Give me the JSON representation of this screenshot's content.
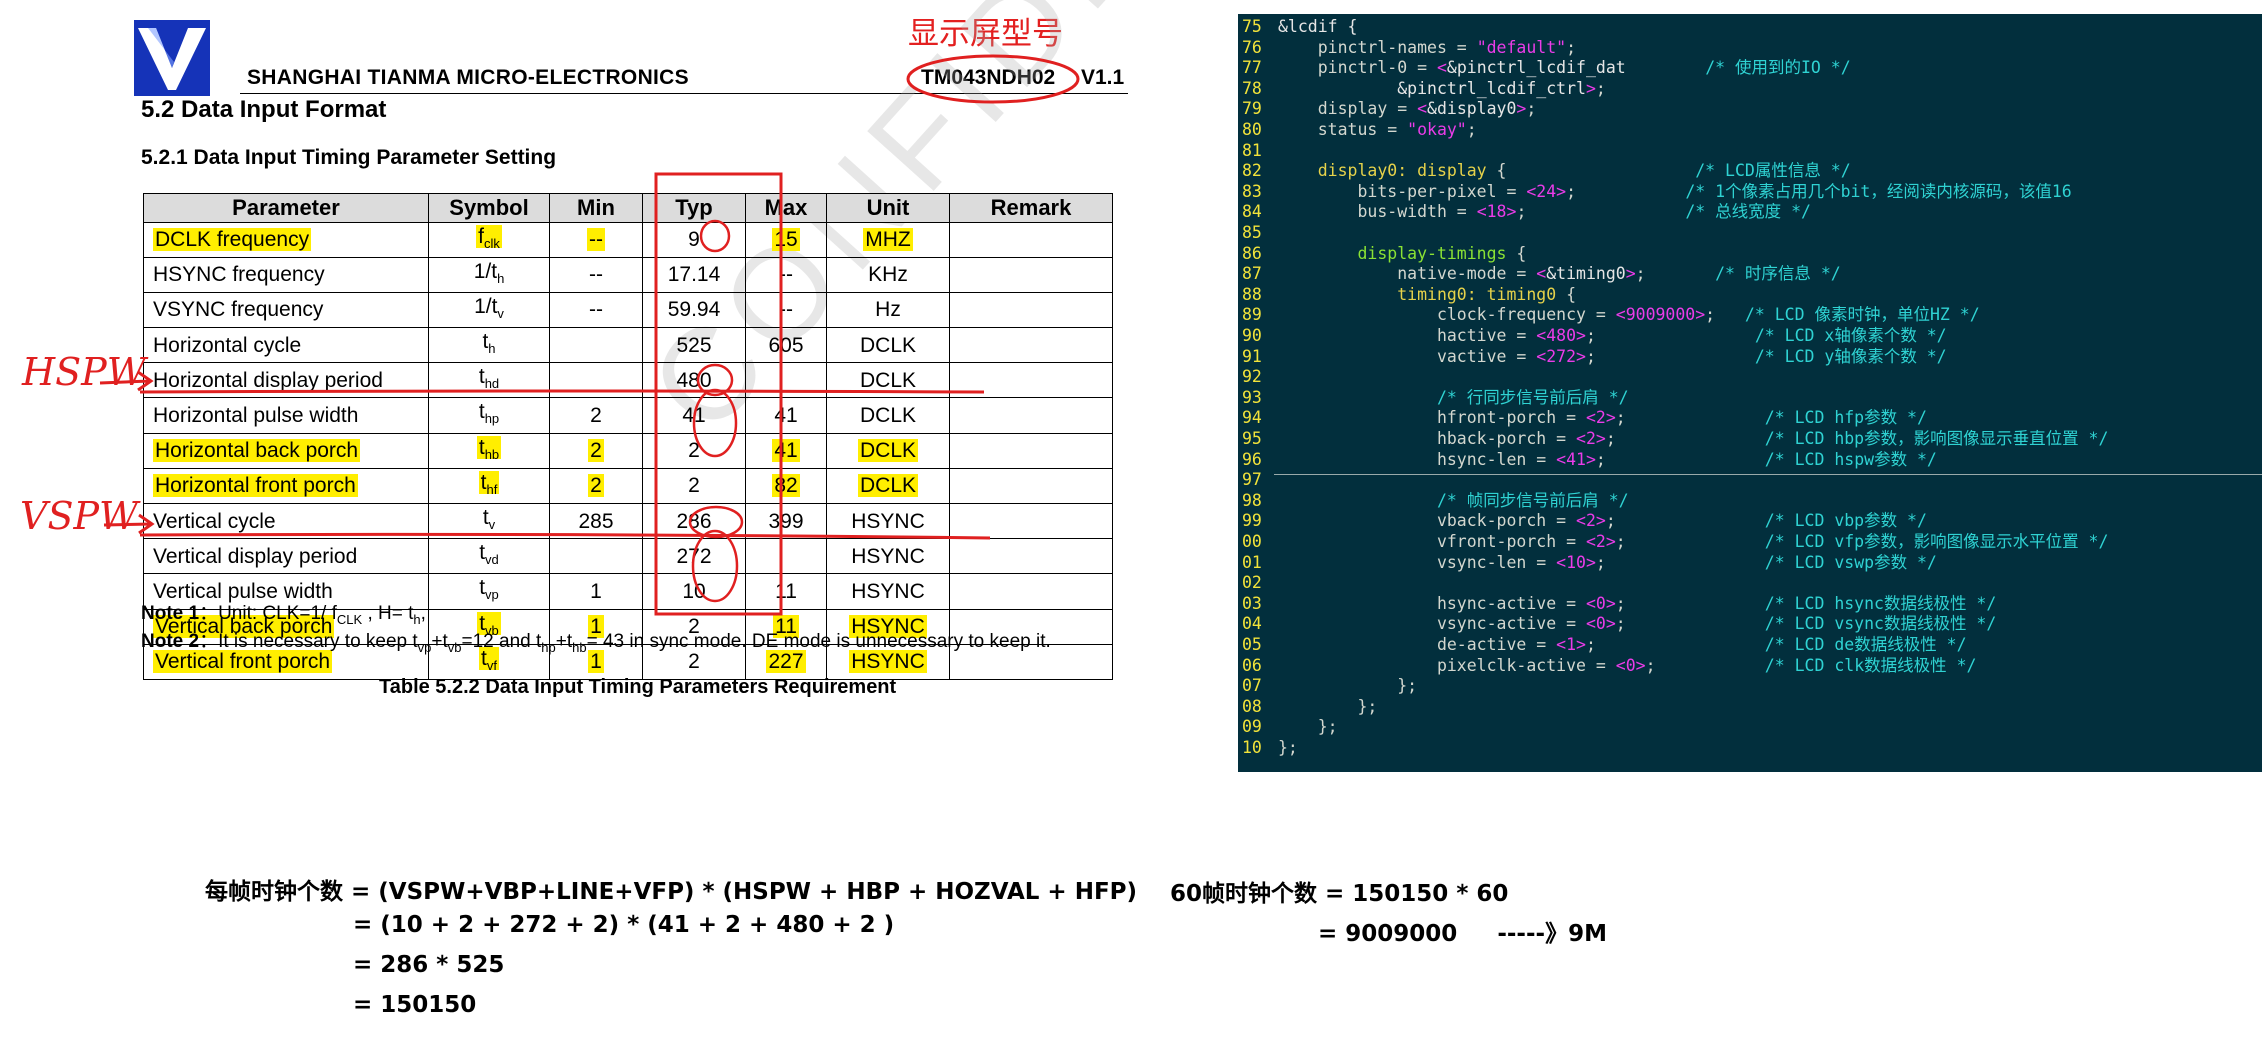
{
  "header": {
    "company": "SHANGHAI TIANMA MICRO-ELECTRONICS",
    "model": "TM043NDH02",
    "version": "V1.1",
    "cn_model_annotation": "显示屏型号"
  },
  "section_title": "5.2 Data Input Format",
  "subsection_title": "5.2.1 Data Input Timing Parameter Setting",
  "table": {
    "headers": [
      "Parameter",
      "Symbol",
      "Min",
      "Typ",
      "Max",
      "Unit",
      "Remark"
    ],
    "rows": [
      {
        "param": "DCLK frequency",
        "sym": "f",
        "sub": "clk",
        "min": "--",
        "typ": "9",
        "max": "15",
        "unit": "MHZ",
        "remark": "",
        "highlight": true
      },
      {
        "param": "HSYNC frequency",
        "sym": "1/t",
        "sub": "h",
        "min": "--",
        "typ": "17.14",
        "max": "--",
        "unit": "KHz",
        "remark": "",
        "highlight": false
      },
      {
        "param": "VSYNC frequency",
        "sym": "1/t",
        "sub": "v",
        "min": "--",
        "typ": "59.94",
        "max": "--",
        "unit": "Hz",
        "remark": "",
        "highlight": false
      },
      {
        "param": "Horizontal cycle",
        "sym": "t",
        "sub": "h",
        "min": "",
        "typ": "525",
        "max": "605",
        "unit": "DCLK",
        "remark": "",
        "highlight": false
      },
      {
        "param": "Horizontal display period",
        "sym": "t",
        "sub": "hd",
        "min": "",
        "typ": "480",
        "max": "",
        "unit": "DCLK",
        "remark": "",
        "highlight": false
      },
      {
        "param": "Horizontal pulse width",
        "sym": "t",
        "sub": "hp",
        "min": "2",
        "typ": "41",
        "max": "41",
        "unit": "DCLK",
        "remark": "",
        "highlight": false
      },
      {
        "param": "Horizontal back porch",
        "sym": "t",
        "sub": "hb",
        "min": "2",
        "typ": "2",
        "max": "41",
        "unit": "DCLK",
        "remark": "",
        "highlight": true
      },
      {
        "param": "Horizontal front porch",
        "sym": "t",
        "sub": "hf",
        "min": "2",
        "typ": "2",
        "max": "82",
        "unit": "DCLK",
        "remark": "",
        "highlight": true
      },
      {
        "param": "Vertical cycle",
        "sym": "t",
        "sub": "v",
        "min": "285",
        "typ": "286",
        "max": "399",
        "unit": "HSYNC",
        "remark": "",
        "highlight": false
      },
      {
        "param": "Vertical display period",
        "sym": "t",
        "sub": "vd",
        "min": "",
        "typ": "272",
        "max": "",
        "unit": "HSYNC",
        "remark": "",
        "highlight": false
      },
      {
        "param": "Vertical pulse width",
        "sym": "t",
        "sub": "vp",
        "min": "1",
        "typ": "10",
        "max": "11",
        "unit": "HSYNC",
        "remark": "",
        "highlight": false
      },
      {
        "param": "Vertical back porch",
        "sym": "t",
        "sub": "vb",
        "min": "1",
        "typ": "2",
        "max": "11",
        "unit": "HSYNC",
        "remark": "",
        "highlight": true
      },
      {
        "param": "Vertical front porch",
        "sym": "t",
        "sub": "vf",
        "min": "1",
        "typ": "2",
        "max": "227",
        "unit": "HSYNC",
        "remark": "",
        "highlight": true
      }
    ]
  },
  "notes": {
    "note1_label": "Note 1",
    "note1_text": "：Unit: CLK=1/ f",
    "note1_sub": "CLK",
    "note1_tail": " , H= t",
    "note1_tail_sub": "h",
    "note1_end": ",",
    "note2_label": "Note 2",
    "note2_text": "：It is necessary to keep t",
    "note2_p1": "vp",
    "note2_p2": "+t",
    "note2_p3": "vb",
    "note2_p4": "=12 and t",
    "note2_p5": "hp",
    "note2_p6": "+t",
    "note2_p7": "hb",
    "note2_p8": "= 43 in sync mode. DE mode is unnecessary to keep it."
  },
  "caption": "Table 5.2.2 Data Input Timing Parameters Requirement",
  "watermark": "CONFIDENTIAL",
  "hand_labels": {
    "hspw": "HSPW",
    "vspw": "VSPW"
  },
  "code": {
    "lines": [
      {
        "n": "75",
        "t": [
          [
            "w",
            "&lcdif {"
          ]
        ]
      },
      {
        "n": "76",
        "t": [
          [
            "d",
            "    pinctrl-names = "
          ],
          [
            "p",
            "\"default\""
          ],
          [
            "d",
            ";"
          ]
        ]
      },
      {
        "n": "77",
        "t": [
          [
            "d",
            "    pinctrl-0 = "
          ],
          [
            "p",
            "<"
          ],
          [
            "w",
            "&pinctrl_lcdif_dat"
          ],
          [
            "d",
            "        "
          ],
          [
            "c",
            "/* 使用到的IO */"
          ]
        ]
      },
      {
        "n": "78",
        "t": [
          [
            "d",
            "            "
          ],
          [
            "w",
            "&pinctrl_lcdif_ctrl"
          ],
          [
            "p",
            ">"
          ],
          [
            "d",
            ";"
          ]
        ]
      },
      {
        "n": "79",
        "t": [
          [
            "d",
            "    display = "
          ],
          [
            "p",
            "<"
          ],
          [
            "w",
            "&display0"
          ],
          [
            "p",
            ">"
          ],
          [
            "d",
            ";"
          ]
        ]
      },
      {
        "n": "80",
        "t": [
          [
            "d",
            "    status = "
          ],
          [
            "p",
            "\"okay\""
          ],
          [
            "d",
            ";"
          ]
        ]
      },
      {
        "n": "81",
        "t": []
      },
      {
        "n": "82",
        "t": [
          [
            "y",
            "    display0: display "
          ],
          [
            "d",
            "{"
          ],
          [
            "d",
            "                   "
          ],
          [
            "c",
            "/* LCD属性信息 */"
          ]
        ]
      },
      {
        "n": "83",
        "t": [
          [
            "d",
            "        bits-per-pixel = "
          ],
          [
            "p",
            "<24>"
          ],
          [
            "d",
            ";"
          ],
          [
            "d",
            "           "
          ],
          [
            "c",
            "/* 1个像素占用几个bit，经阅读内核源码，该值16"
          ]
        ]
      },
      {
        "n": "84",
        "t": [
          [
            "d",
            "        bus-width = "
          ],
          [
            "p",
            "<18>"
          ],
          [
            "d",
            ";"
          ],
          [
            "d",
            "                "
          ],
          [
            "c",
            "/* 总线宽度 */"
          ]
        ]
      },
      {
        "n": "85",
        "t": []
      },
      {
        "n": "86",
        "t": [
          [
            "g",
            "        display-timings "
          ],
          [
            "d",
            "{"
          ]
        ]
      },
      {
        "n": "87",
        "t": [
          [
            "d",
            "            native-mode = "
          ],
          [
            "p",
            "<"
          ],
          [
            "w",
            "&timing0"
          ],
          [
            "p",
            ">"
          ],
          [
            "d",
            ";"
          ],
          [
            "d",
            "       "
          ],
          [
            "c",
            "/* 时序信息 */"
          ]
        ]
      },
      {
        "n": "88",
        "t": [
          [
            "y",
            "            timing0: timing0 "
          ],
          [
            "d",
            "{"
          ]
        ]
      },
      {
        "n": "89",
        "t": [
          [
            "d",
            "                clock-frequency = "
          ],
          [
            "p",
            "<9009000>"
          ],
          [
            "d",
            ";"
          ],
          [
            "d",
            "   "
          ],
          [
            "c",
            "/* LCD 像素时钟，单位HZ */"
          ]
        ]
      },
      {
        "n": "90",
        "t": [
          [
            "d",
            "                hactive = "
          ],
          [
            "p",
            "<480>"
          ],
          [
            "d",
            ";"
          ],
          [
            "d",
            "                "
          ],
          [
            "c",
            "/* LCD x轴像素个数 */"
          ]
        ]
      },
      {
        "n": "91",
        "t": [
          [
            "d",
            "                vactive = "
          ],
          [
            "p",
            "<272>"
          ],
          [
            "d",
            ";"
          ],
          [
            "d",
            "                "
          ],
          [
            "c",
            "/* LCD y轴像素个数 */"
          ]
        ]
      },
      {
        "n": "92",
        "t": []
      },
      {
        "n": "93",
        "t": [
          [
            "d",
            "                "
          ],
          [
            "c",
            "/* 行同步信号前后肩 */"
          ]
        ]
      },
      {
        "n": "94",
        "t": [
          [
            "d",
            "                hfront-porch = "
          ],
          [
            "p",
            "<2>"
          ],
          [
            "d",
            ";"
          ],
          [
            "d",
            "              "
          ],
          [
            "c",
            "/* LCD hfp参数 */"
          ]
        ]
      },
      {
        "n": "95",
        "t": [
          [
            "d",
            "                hback-porch = "
          ],
          [
            "p",
            "<2>"
          ],
          [
            "d",
            ";"
          ],
          [
            "d",
            "               "
          ],
          [
            "c",
            "/* LCD hbp参数，影响图像显示垂直位置 */"
          ]
        ]
      },
      {
        "n": "96",
        "t": [
          [
            "d",
            "                hsync-len = "
          ],
          [
            "p",
            "<41>"
          ],
          [
            "d",
            ";"
          ],
          [
            "d",
            "                "
          ],
          [
            "c",
            "/* LCD hspw参数 */"
          ]
        ]
      },
      {
        "n": "97",
        "t": []
      },
      {
        "n": "98",
        "t": [
          [
            "d",
            "                "
          ],
          [
            "c",
            "/* 帧同步信号前后肩 */"
          ]
        ]
      },
      {
        "n": "99",
        "t": [
          [
            "d",
            "                vback-porch = "
          ],
          [
            "p",
            "<2>"
          ],
          [
            "d",
            ";"
          ],
          [
            "d",
            "               "
          ],
          [
            "c",
            "/* LCD vbp参数 */"
          ]
        ]
      },
      {
        "n": "00",
        "t": [
          [
            "d",
            "                vfront-porch = "
          ],
          [
            "p",
            "<2>"
          ],
          [
            "d",
            ";"
          ],
          [
            "d",
            "              "
          ],
          [
            "c",
            "/* LCD vfp参数，影响图像显示水平位置 */"
          ]
        ]
      },
      {
        "n": "01",
        "t": [
          [
            "d",
            "                vsync-len = "
          ],
          [
            "p",
            "<10>"
          ],
          [
            "d",
            ";"
          ],
          [
            "d",
            "                "
          ],
          [
            "c",
            "/* LCD vswp参数 */"
          ]
        ]
      },
      {
        "n": "02",
        "t": []
      },
      {
        "n": "03",
        "t": [
          [
            "d",
            "                hsync-active = "
          ],
          [
            "p",
            "<0>"
          ],
          [
            "d",
            ";"
          ],
          [
            "d",
            "              "
          ],
          [
            "c",
            "/* LCD hsync数据线极性 */"
          ]
        ]
      },
      {
        "n": "04",
        "t": [
          [
            "d",
            "                vsync-active = "
          ],
          [
            "p",
            "<0>"
          ],
          [
            "d",
            ";"
          ],
          [
            "d",
            "              "
          ],
          [
            "c",
            "/* LCD vsync数据线极性 */"
          ]
        ]
      },
      {
        "n": "05",
        "t": [
          [
            "d",
            "                de-active = "
          ],
          [
            "p",
            "<1>"
          ],
          [
            "d",
            ";"
          ],
          [
            "d",
            "                 "
          ],
          [
            "c",
            "/* LCD de数据线极性 */"
          ]
        ]
      },
      {
        "n": "06",
        "t": [
          [
            "d",
            "                pixelclk-active = "
          ],
          [
            "p",
            "<0>"
          ],
          [
            "d",
            ";"
          ],
          [
            "d",
            "           "
          ],
          [
            "c",
            "/* LCD clk数据线极性 */"
          ]
        ]
      },
      {
        "n": "07",
        "t": [
          [
            "d",
            "            };"
          ]
        ]
      },
      {
        "n": "08",
        "t": [
          [
            "d",
            "        };"
          ]
        ]
      },
      {
        "n": "09",
        "t": [
          [
            "d",
            "    };"
          ]
        ]
      },
      {
        "n": "10",
        "t": [
          [
            "d",
            "};"
          ]
        ]
      }
    ]
  },
  "formulas": {
    "left": [
      "每帧时钟个数 = (VSPW+VBP+LINE+VFP) * (HSPW + HBP + HOZVAL + HFP)",
      "= (10 + 2 + 272 + 2) * (41 + 2 + 480 + 2 )",
      "= 286 * 525",
      "= 150150"
    ],
    "right": [
      "60帧时钟个数 = 150150 * 60",
      "= 9009000     -----》9M"
    ]
  },
  "colors": {
    "highlight": "#ffee00",
    "annotation_red": "#e02020",
    "code_bg": "#022f3d",
    "logo_blue": "#1533b8"
  }
}
